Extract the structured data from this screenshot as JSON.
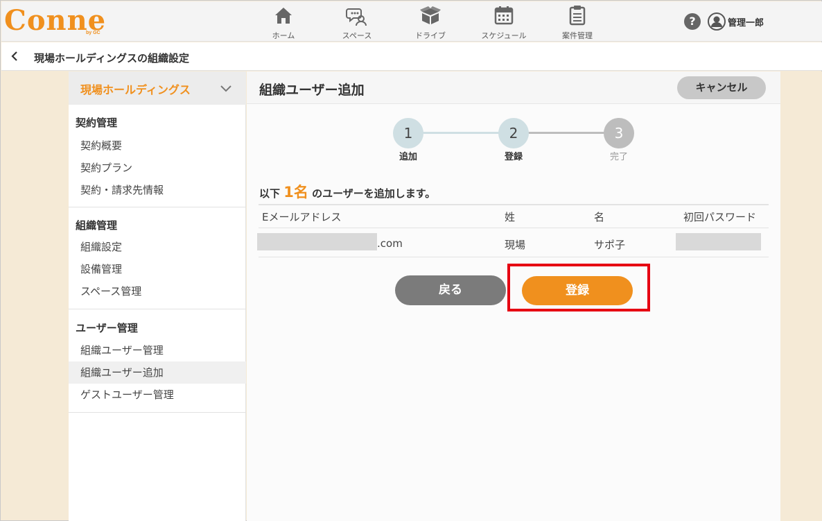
{
  "brand": {
    "logo": "Conne",
    "logo_sub": "by GC",
    "accent": "#f0901e"
  },
  "nav": [
    {
      "label": "ホーム",
      "icon": "home-icon"
    },
    {
      "label": "スペース",
      "icon": "chat-people-icon"
    },
    {
      "label": "ドライブ",
      "icon": "box-icon"
    },
    {
      "label": "スケジュール",
      "icon": "calendar-icon"
    },
    {
      "label": "案件管理",
      "icon": "clipboard-icon"
    }
  ],
  "user": {
    "name": "管理一郎",
    "help_icon": "question-icon",
    "avatar_icon": "user-avatar-icon"
  },
  "breadcrumb": {
    "title": "現場ホールディングスの組織設定"
  },
  "sidebar": {
    "org_name": "現場ホールディングス",
    "groups": [
      {
        "heading": "契約管理",
        "items": [
          "契約概要",
          "契約プラン",
          "契約・請求先情報"
        ]
      },
      {
        "heading": "組織管理",
        "items": [
          "組織設定",
          "設備管理",
          "スペース管理"
        ]
      },
      {
        "heading": "ユーザー管理",
        "items": [
          "組織ユーザー管理",
          "組織ユーザー追加",
          "ゲストユーザー管理"
        ]
      }
    ],
    "active_item": "組織ユーザー追加"
  },
  "main": {
    "title": "組織ユーザー追加",
    "cancel_label": "キャンセル",
    "steps": [
      {
        "number": "1",
        "label": "追加",
        "state": "done"
      },
      {
        "number": "2",
        "label": "登録",
        "state": "current"
      },
      {
        "number": "3",
        "label": "完了",
        "state": "todo"
      }
    ],
    "summary_prefix": "以下",
    "summary_count": "1名",
    "summary_suffix": "のユーザーを追加します。",
    "table": {
      "headers": [
        "Eメールアドレス",
        "姓",
        "名",
        "初回パスワード"
      ],
      "rows": [
        {
          "email_suffix": ".com",
          "last_name": "現場",
          "first_name": "サポ子"
        }
      ]
    },
    "back_label": "戻る",
    "register_label": "登録"
  },
  "colors": {
    "step_done": "#cfdfe3",
    "step_todo": "#bdbdbd",
    "highlight": "#e60012",
    "back_button": "#7b7b7b"
  }
}
